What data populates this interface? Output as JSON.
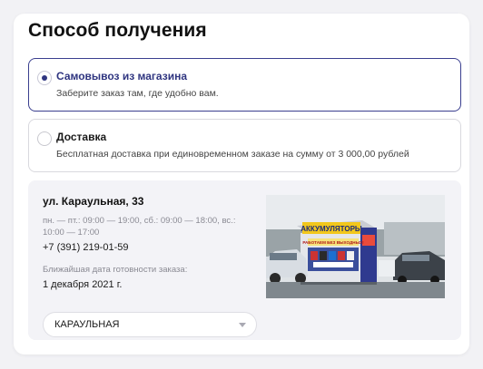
{
  "page": {
    "title": "Способ получения"
  },
  "options": [
    {
      "title": "Самовывоз из магазина",
      "description": "Заберите заказ там, где удобно вам.",
      "selected": true
    },
    {
      "title": "Доставка",
      "description": "Бесплатная доставка при единовременном заказе на сумму от 3 000,00 рублей",
      "selected": false
    }
  ],
  "pickup": {
    "address": "ул. Караульная, 33",
    "hours": "пн. — пт.: 09:00 — 19:00, сб.: 09:00 — 18:00, вс.: 10:00 — 17:00",
    "phone": "+7 (391) 219-01-59",
    "ready_label": "Ближайшая дата готовности заказа:",
    "ready_date": "1 декабря 2021 г.",
    "store_select": {
      "value": "КАРАУЛЬНАЯ"
    },
    "photo": {
      "sign_text": "АККУМУЛЯТОРЫ",
      "banner_text": "РАБОТАЕМ БЕЗ ВЫХОДНЫХ!"
    }
  },
  "colors": {
    "accent": "#2f3580",
    "selected_border": "#3a3f8f",
    "panel_bg": "#f3f3f7"
  }
}
